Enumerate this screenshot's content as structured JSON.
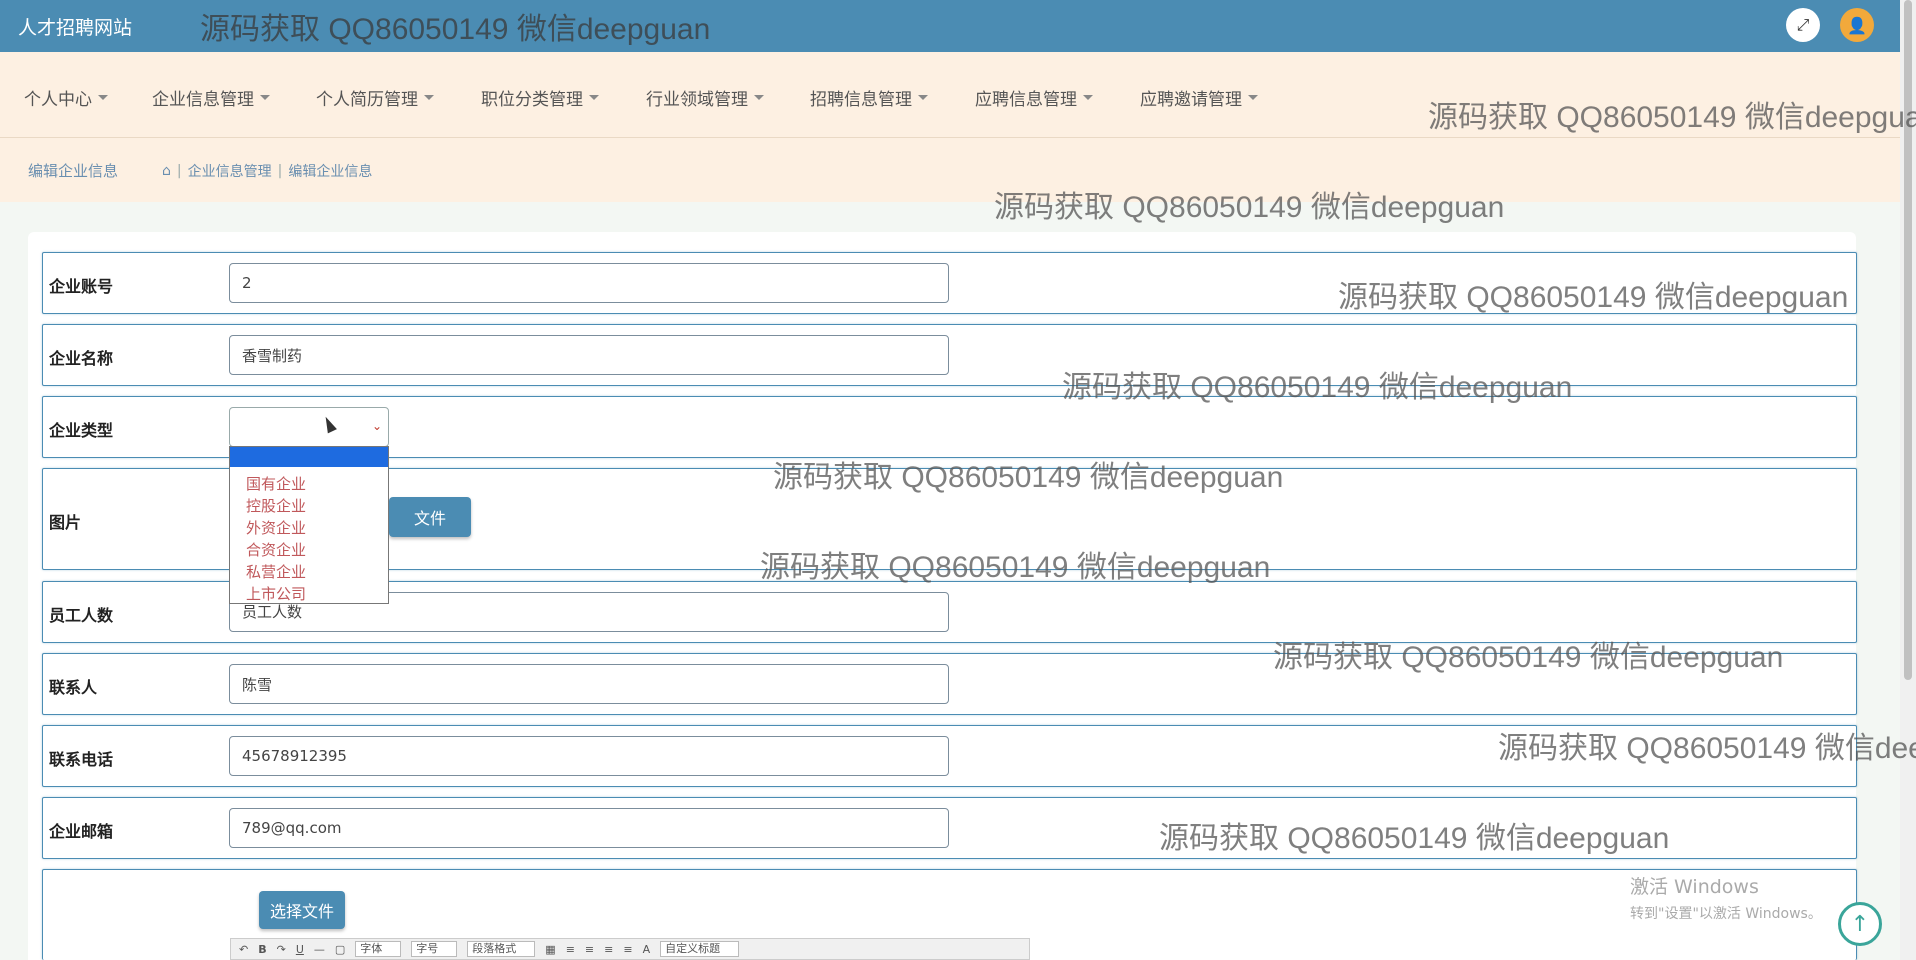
{
  "brand": "人才招聘网站",
  "watermark_text": "源码获取 QQ86050149 微信deepguan",
  "nav": {
    "items": [
      "个人中心",
      "企业信息管理",
      "个人简历管理",
      "职位分类管理",
      "行业领域管理",
      "招聘信息管理",
      "应聘信息管理",
      "应聘邀请管理"
    ]
  },
  "breadcrumb": {
    "heading": "编辑企业信息",
    "path": [
      "企业信息管理",
      "编辑企业信息"
    ]
  },
  "form": {
    "account": {
      "label": "企业账号",
      "value": "2"
    },
    "name": {
      "label": "企业名称",
      "value": "香雪制药"
    },
    "type": {
      "label": "企业类型",
      "value": "",
      "options": [
        "国有企业",
        "控股企业",
        "外资企业",
        "合资企业",
        "私营企业",
        "上市公司"
      ]
    },
    "image": {
      "label": "图片",
      "button": "文件"
    },
    "staff": {
      "label": "员工人数",
      "placeholder": "员工人数"
    },
    "contact": {
      "label": "联系人",
      "value": "陈雪"
    },
    "phone": {
      "label": "联系电话",
      "value": "45678912395"
    },
    "email": {
      "label": "企业邮箱",
      "value": "789@qq.com"
    },
    "detail": {
      "choose_file": "选择文件"
    }
  },
  "editor_toolbar": {
    "font": "字体",
    "size": "字号",
    "paragraph": "段落格式",
    "custom_title": "自定义标题"
  },
  "windows_activation": {
    "line1": "激活 Windows",
    "line2": "转到\"设置\"以激活 Windows。"
  },
  "colors": {
    "topbar": "#4b8cb3",
    "nav_bg": "#fdf0e2",
    "accent": "#4b8cb3"
  }
}
